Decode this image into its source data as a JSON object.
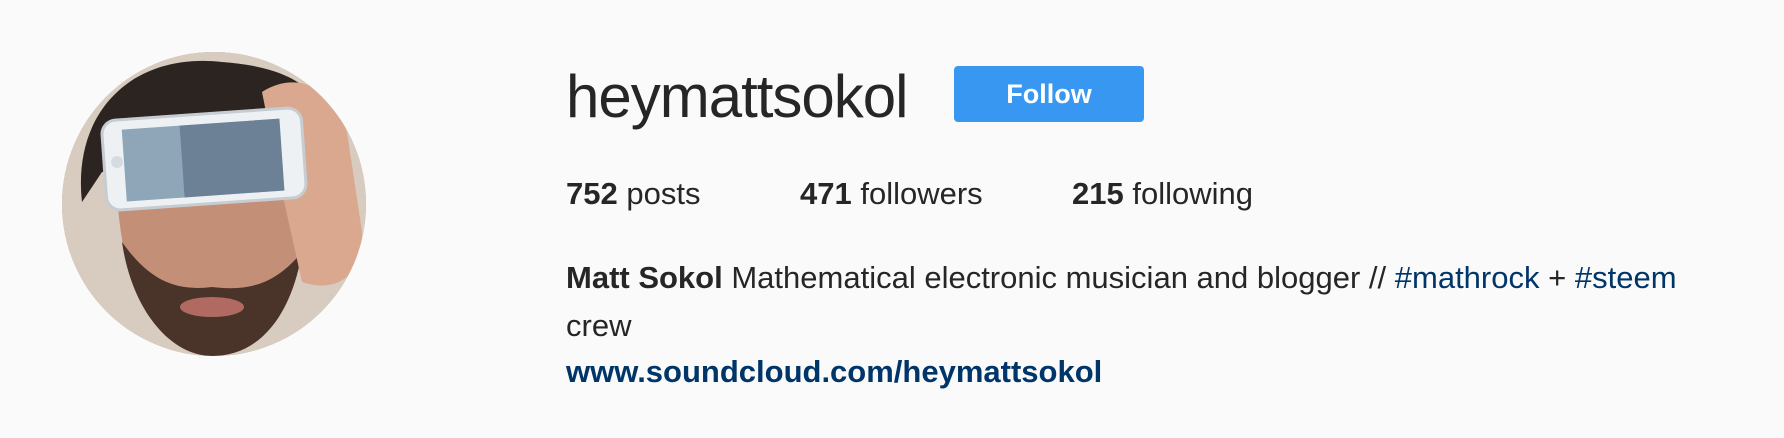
{
  "profile": {
    "username": "heymattsokol",
    "follow_label": "Follow",
    "stats": {
      "posts_count": "752",
      "posts_label": "posts",
      "followers_count": "471",
      "followers_label": "followers",
      "following_count": "215",
      "following_label": "following"
    },
    "bio": {
      "name": "Matt Sokol",
      "text_before": "Mathematical electronic musician and blogger //",
      "hashtag1": "#mathrock",
      "plus": "+",
      "hashtag2": "#steem",
      "text_after": "crew"
    },
    "website": "www.soundcloud.com/heymattsokol"
  },
  "colors": {
    "background": "#fafafa",
    "follow_button": "#3897f0",
    "link": "#003569",
    "text": "#262626"
  }
}
